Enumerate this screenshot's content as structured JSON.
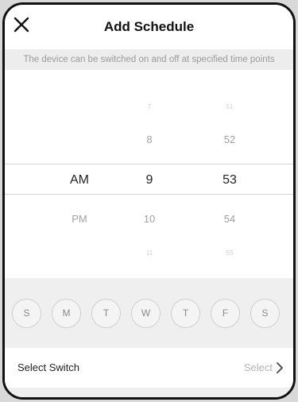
{
  "header": {
    "title": "Add Schedule",
    "close_icon": "close-icon"
  },
  "subtitle": "The device can be switched on and off at specified time points",
  "time_picker": {
    "period": {
      "visible": [
        "AM",
        "PM"
      ],
      "selected": "AM"
    },
    "hour": {
      "visible": [
        "7",
        "8",
        "9",
        "10",
        "11"
      ],
      "selected": "9"
    },
    "minute": {
      "visible": [
        "51",
        "52",
        "53",
        "54",
        "55"
      ],
      "selected": "53"
    }
  },
  "days": [
    "S",
    "M",
    "T",
    "W",
    "T",
    "F",
    "S"
  ],
  "select_switch": {
    "label": "Select Switch",
    "value": "Select",
    "chevron_icon": "chevron-right-icon"
  },
  "colors": {
    "frame": "#111111",
    "background": "#f7f7f7",
    "selected_text": "#222222",
    "muted_text": "#a8a8a8"
  }
}
